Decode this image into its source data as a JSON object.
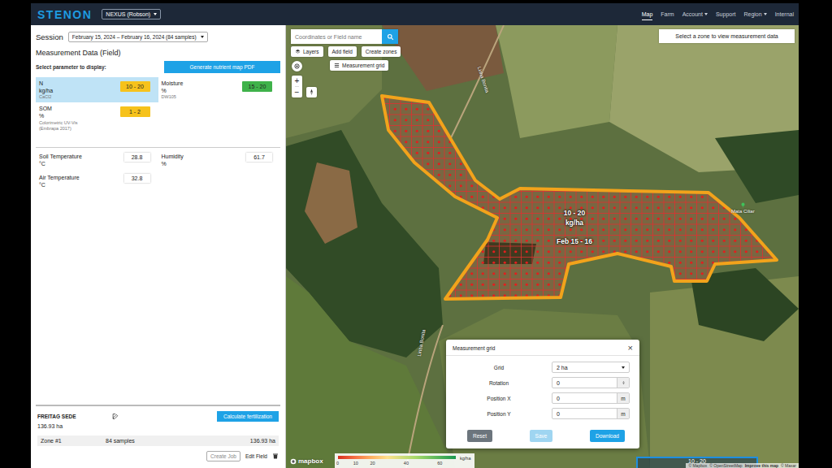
{
  "header": {
    "logo": "STENON",
    "account": "NEXUS (Robson)",
    "nav": [
      {
        "label": "Map",
        "selected": true,
        "has_menu": false
      },
      {
        "label": "Farm",
        "selected": false,
        "has_menu": false
      },
      {
        "label": "Account",
        "selected": false,
        "has_menu": true
      },
      {
        "label": "Support",
        "selected": false,
        "has_menu": false
      },
      {
        "label": "Region",
        "selected": false,
        "has_menu": true
      },
      {
        "label": "Internal",
        "selected": false,
        "has_menu": false
      }
    ]
  },
  "session": {
    "label": "Session",
    "value": "February 15, 2024 – February 16, 2024 (84 samples)"
  },
  "measurement": {
    "title": "Measurement Data (Field)",
    "prompt": "Select parameter to display:",
    "pdf_button": "Generate nutrient map PDF",
    "parameters": [
      {
        "name": "N",
        "unit": "kg/ha",
        "method": [
          "CaCl2"
        ],
        "value": "10 - 20",
        "color": "#f6c21c",
        "selected": true
      },
      {
        "name": "Moisture",
        "unit": "%",
        "method": [
          "DW105"
        ],
        "value": "15 - 20",
        "color": "#3fb24a",
        "selected": false
      },
      {
        "name": "SOM",
        "unit": "%",
        "method": [
          "Colorimetric UV-Vis",
          "(Embrapa 2017)"
        ],
        "value": "1 - 2",
        "color": "#f6c21c",
        "selected": false
      }
    ],
    "readings": [
      {
        "name": "Soil Temperature",
        "unit": "°C",
        "value": "28.8"
      },
      {
        "name": "Humidity",
        "unit": "%",
        "value": "61.7"
      },
      {
        "name": "Air Temperature",
        "unit": "°C",
        "value": "32.8"
      }
    ]
  },
  "field": {
    "name": "FREITAG SEDE",
    "calc_button": "Calculate fertilization",
    "area": "136.93 ha",
    "zones": [
      {
        "name": "Zone #1",
        "samples": "84 samples",
        "area": "136.93 ha"
      }
    ],
    "actions": [
      {
        "label": "Create Job",
        "disabled": true
      },
      {
        "label": "Edit Field",
        "disabled": false
      }
    ]
  },
  "map": {
    "search": {
      "placeholder": "Coordinates or Field name"
    },
    "tools": [
      "Layers",
      "Add field",
      "Create zones"
    ],
    "grid_button": "Measurement grid",
    "zoom_in": "+",
    "zoom_out": "−",
    "hint": "Select a zone to view measurement data",
    "overlay": {
      "value": "10 - 20",
      "unit": "kg/ha",
      "date": "Feb 15 - 16"
    },
    "places": [
      {
        "text": "Mata Ciliar",
        "kind": "poi"
      },
      {
        "text": "Linha Bonita",
        "kind": "road"
      },
      {
        "text": "Linha Bonita",
        "kind": "road"
      }
    ],
    "legend": {
      "ticks": [
        "0",
        "10",
        "20",
        "40",
        "60"
      ],
      "unit": "kg/ha"
    },
    "logo": "mapbox",
    "attribution": [
      "© Mapbox",
      "© OpenStreetMap",
      "Improve this map",
      "© Maxar"
    ],
    "corner_badge": "10 - 20"
  },
  "dialog": {
    "title": "Measurement grid",
    "close": "×",
    "fields": [
      {
        "label": "Grid",
        "value": "2 ha",
        "kind": "select"
      },
      {
        "label": "Rotation",
        "value": "0",
        "kind": "spinner"
      },
      {
        "label": "Position X",
        "value": "0",
        "kind": "unit",
        "unit": "m"
      },
      {
        "label": "Position Y",
        "value": "0",
        "kind": "unit",
        "unit": "m"
      }
    ],
    "buttons": [
      {
        "label": "Reset",
        "kind": "secondary",
        "disabled": false
      },
      {
        "label": "Save",
        "kind": "muted",
        "disabled": true
      },
      {
        "label": "Download",
        "kind": "primary",
        "disabled": false
      }
    ]
  }
}
